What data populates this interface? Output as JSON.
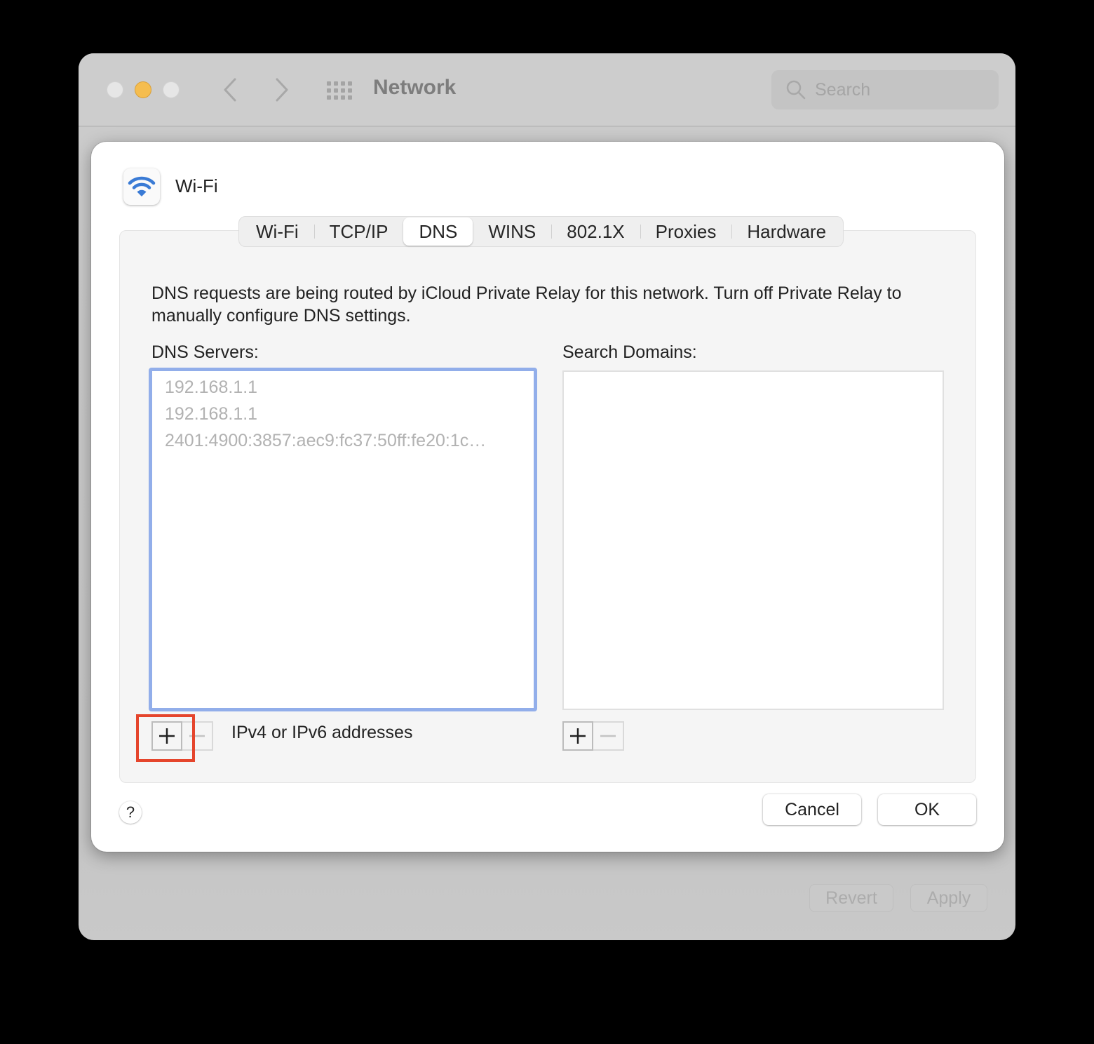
{
  "window": {
    "title": "Network",
    "search_placeholder": "Search",
    "traffic_lights": {
      "close": "#e6e6e6",
      "minimize": "#f5bd4f",
      "zoom": "#e6e6e6"
    },
    "footer_buttons": {
      "revert": "Revert",
      "apply": "Apply"
    }
  },
  "sheet": {
    "interface_name": "Wi-Fi",
    "tabs": [
      {
        "label": "Wi-Fi",
        "active": false
      },
      {
        "label": "TCP/IP",
        "active": false
      },
      {
        "label": "DNS",
        "active": true
      },
      {
        "label": "WINS",
        "active": false
      },
      {
        "label": "802.1X",
        "active": false
      },
      {
        "label": "Proxies",
        "active": false
      },
      {
        "label": "Hardware",
        "active": false
      }
    ],
    "notice": "DNS requests are being routed by iCloud Private Relay for this network. Turn off Private Relay to manually configure DNS settings.",
    "dns_servers": {
      "label": "DNS Servers:",
      "items": [
        "192.168.1.1",
        "192.168.1.1",
        "2401:4900:3857:aec9:fc37:50ff:fe20:1c…"
      ],
      "hint": "IPv4 or IPv6 addresses",
      "add_symbol": "+",
      "remove_symbol": "−"
    },
    "search_domains": {
      "label": "Search Domains:",
      "items": [],
      "add_symbol": "+",
      "remove_symbol": "−"
    },
    "help_label": "?",
    "cancel_label": "Cancel",
    "ok_label": "OK"
  },
  "colors": {
    "focus_ring": "#92aeea",
    "annotation_highlight": "#e5452c",
    "wifi_icon": "#3a7bd5"
  }
}
